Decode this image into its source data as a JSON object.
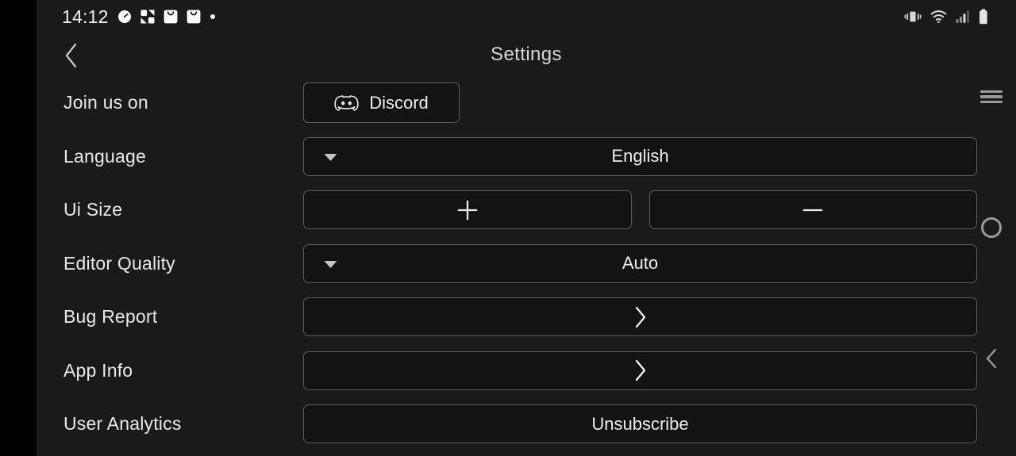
{
  "status_bar": {
    "time": "14:12",
    "left_icons": [
      {
        "name": "speedometer-icon"
      },
      {
        "name": "app-tile-icon"
      },
      {
        "name": "shopping-bag-icon"
      },
      {
        "name": "shopping-bag-icon-2"
      },
      {
        "name": "dot-indicator-icon"
      }
    ],
    "right_icons": [
      {
        "name": "vibrate-mode-icon"
      },
      {
        "name": "wifi-icon"
      },
      {
        "name": "cellular-signal-icon"
      },
      {
        "name": "battery-icon"
      }
    ]
  },
  "header": {
    "title": "Settings",
    "back_icon": "chevron-left-icon"
  },
  "settings": {
    "rows": [
      {
        "label": "Join us on",
        "control": "discord-button",
        "value": "Discord",
        "icon": "discord-logo-icon"
      },
      {
        "label": "Language",
        "control": "dropdown",
        "value": "English",
        "icon": "caret-down-icon"
      },
      {
        "label": "Ui Size",
        "control": "stepper",
        "increase_label": "+",
        "decrease_label": "—",
        "increase_icon": "plus-icon",
        "decrease_icon": "minus-icon"
      },
      {
        "label": "Editor Quality",
        "control": "dropdown",
        "value": "Auto",
        "icon": "caret-down-icon"
      },
      {
        "label": "Bug Report",
        "control": "navigate",
        "icon": "chevron-right-icon"
      },
      {
        "label": "App Info",
        "control": "navigate",
        "icon": "chevron-right-icon"
      },
      {
        "label": "User Analytics",
        "control": "action-button",
        "value": "Unsubscribe"
      }
    ]
  },
  "nav_bar": {
    "recents": "recents-icon",
    "home": "home-icon",
    "back": "back-icon"
  },
  "colors": {
    "background": "#1a1a1a",
    "edge_black": "#000000",
    "button_fill": "#131313",
    "button_border": "#5d5d5d",
    "text_primary": "#e9e9e9",
    "text_title": "#d8d8d8",
    "nav_icon": "#9a9a9a"
  }
}
